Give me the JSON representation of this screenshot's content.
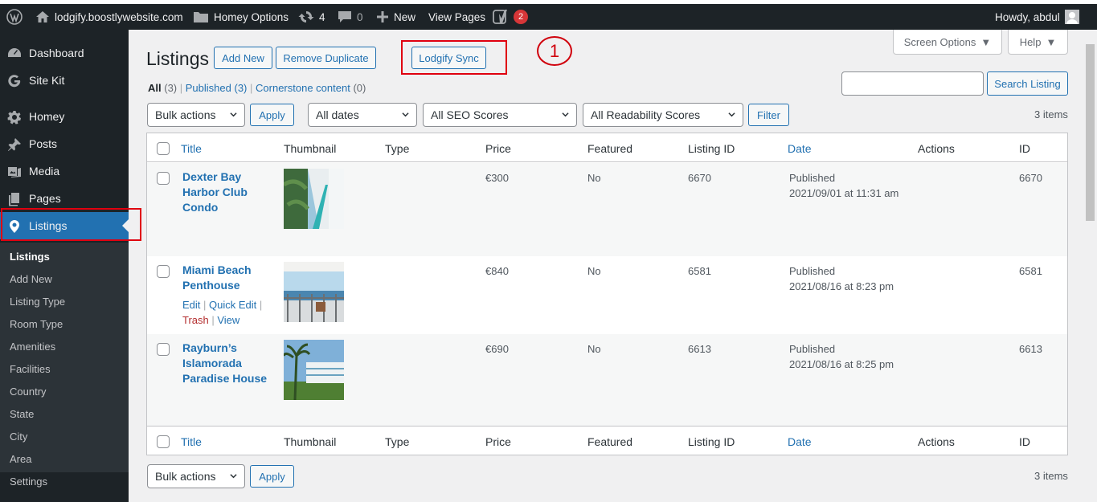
{
  "adminbar": {
    "site": "lodgify.boostlywebsite.com",
    "theme_options": "Homey Options",
    "updates_count": "4",
    "comments_count": "0",
    "new_label": "New",
    "view_pages": "View Pages",
    "yoast_count": "2",
    "howdy": "Howdy, abdul"
  },
  "sidebar": {
    "items": [
      {
        "label": "Dashboard",
        "icon": "dashboard-icon"
      },
      {
        "label": "Site Kit",
        "icon": "google-g-icon"
      },
      {
        "label": "Homey",
        "icon": "gear-icon"
      },
      {
        "label": "Posts",
        "icon": "pin-icon"
      },
      {
        "label": "Media",
        "icon": "media-icon"
      },
      {
        "label": "Pages",
        "icon": "pages-icon"
      },
      {
        "label": "Listings",
        "icon": "location-marker-icon"
      }
    ],
    "submenu": [
      "Listings",
      "Add New",
      "Listing Type",
      "Room Type",
      "Amenities",
      "Facilities",
      "Country",
      "State",
      "City",
      "Area",
      "Settings"
    ]
  },
  "tabs": {
    "screen_options": "Screen Options",
    "help": "Help"
  },
  "header": {
    "title": "Listings",
    "add_new": "Add New",
    "remove_duplicate": "Remove Duplicate",
    "lodgify_sync": "Lodgify Sync",
    "annotation_number": "1"
  },
  "filters_views": {
    "all": "All",
    "all_count": "(3)",
    "published": "Published",
    "published_count": "(3)",
    "cornerstone": "Cornerstone content",
    "cornerstone_count": "(0)"
  },
  "search": {
    "placeholder": "",
    "button": "Search Listing"
  },
  "tablenav": {
    "bulk_actions": "Bulk actions",
    "apply": "Apply",
    "dates": "All dates",
    "seo": "All SEO Scores",
    "readability": "All Readability Scores",
    "filter": "Filter",
    "items_count": "3 items"
  },
  "columns": [
    "Title",
    "Thumbnail",
    "Type",
    "Price",
    "Featured",
    "Listing ID",
    "Date",
    "Actions",
    "ID"
  ],
  "rows": [
    {
      "title": "Dexter Bay Harbor Club Condo",
      "type": "",
      "price": "€300",
      "featured": "No",
      "listing_id": "6670",
      "status": "Published",
      "date": "2021/09/01 at 11:31 am",
      "id": "6670"
    },
    {
      "title": "Miami Beach Penthouse",
      "type": "",
      "price": "€840",
      "featured": "No",
      "listing_id": "6581",
      "status": "Published",
      "date": "2021/08/16 at 8:23 pm",
      "id": "6581",
      "row_actions": {
        "edit": "Edit",
        "quick_edit": "Quick Edit",
        "trash": "Trash",
        "view": "View"
      }
    },
    {
      "title": "Rayburn’s Islamorada Paradise House",
      "type": "",
      "price": "€690",
      "featured": "No",
      "listing_id": "6613",
      "status": "Published",
      "date": "2021/08/16 at 8:25 pm",
      "id": "6613"
    }
  ],
  "colors": {
    "accent": "#2271b1",
    "adminbar": "#1d2327",
    "annotation": "#e0000f"
  }
}
